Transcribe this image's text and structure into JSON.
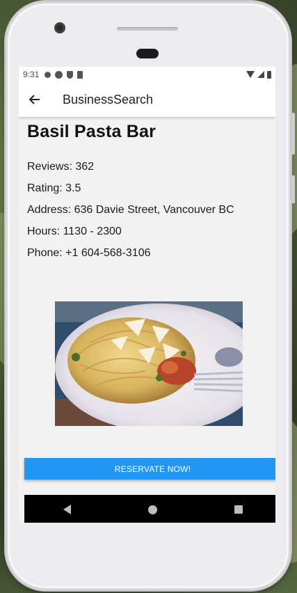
{
  "status_bar": {
    "time": "9:31",
    "icons": [
      "gear-icon",
      "android-a-icon",
      "shield-icon",
      "sd-card-icon",
      "wifi-icon",
      "signal-icon",
      "battery-icon"
    ]
  },
  "app_bar": {
    "title": "BusinessSearch",
    "back_icon": "arrow-left-icon"
  },
  "business": {
    "name": "Basil Pasta Bar",
    "reviews": "Reviews: 362",
    "rating": "Rating: 3.5",
    "address": "Address: 636 Davie Street, Vancouver BC",
    "hours": "Hours: 1130 - 2300",
    "phone": "Phone: +1 604-568-3106"
  },
  "reserve_button": {
    "label": "RESERVATE NOW!",
    "color": "#2196f3"
  },
  "nav_bar": {
    "icons": [
      "back-triangle-icon",
      "home-circle-icon",
      "recents-square-icon"
    ]
  }
}
